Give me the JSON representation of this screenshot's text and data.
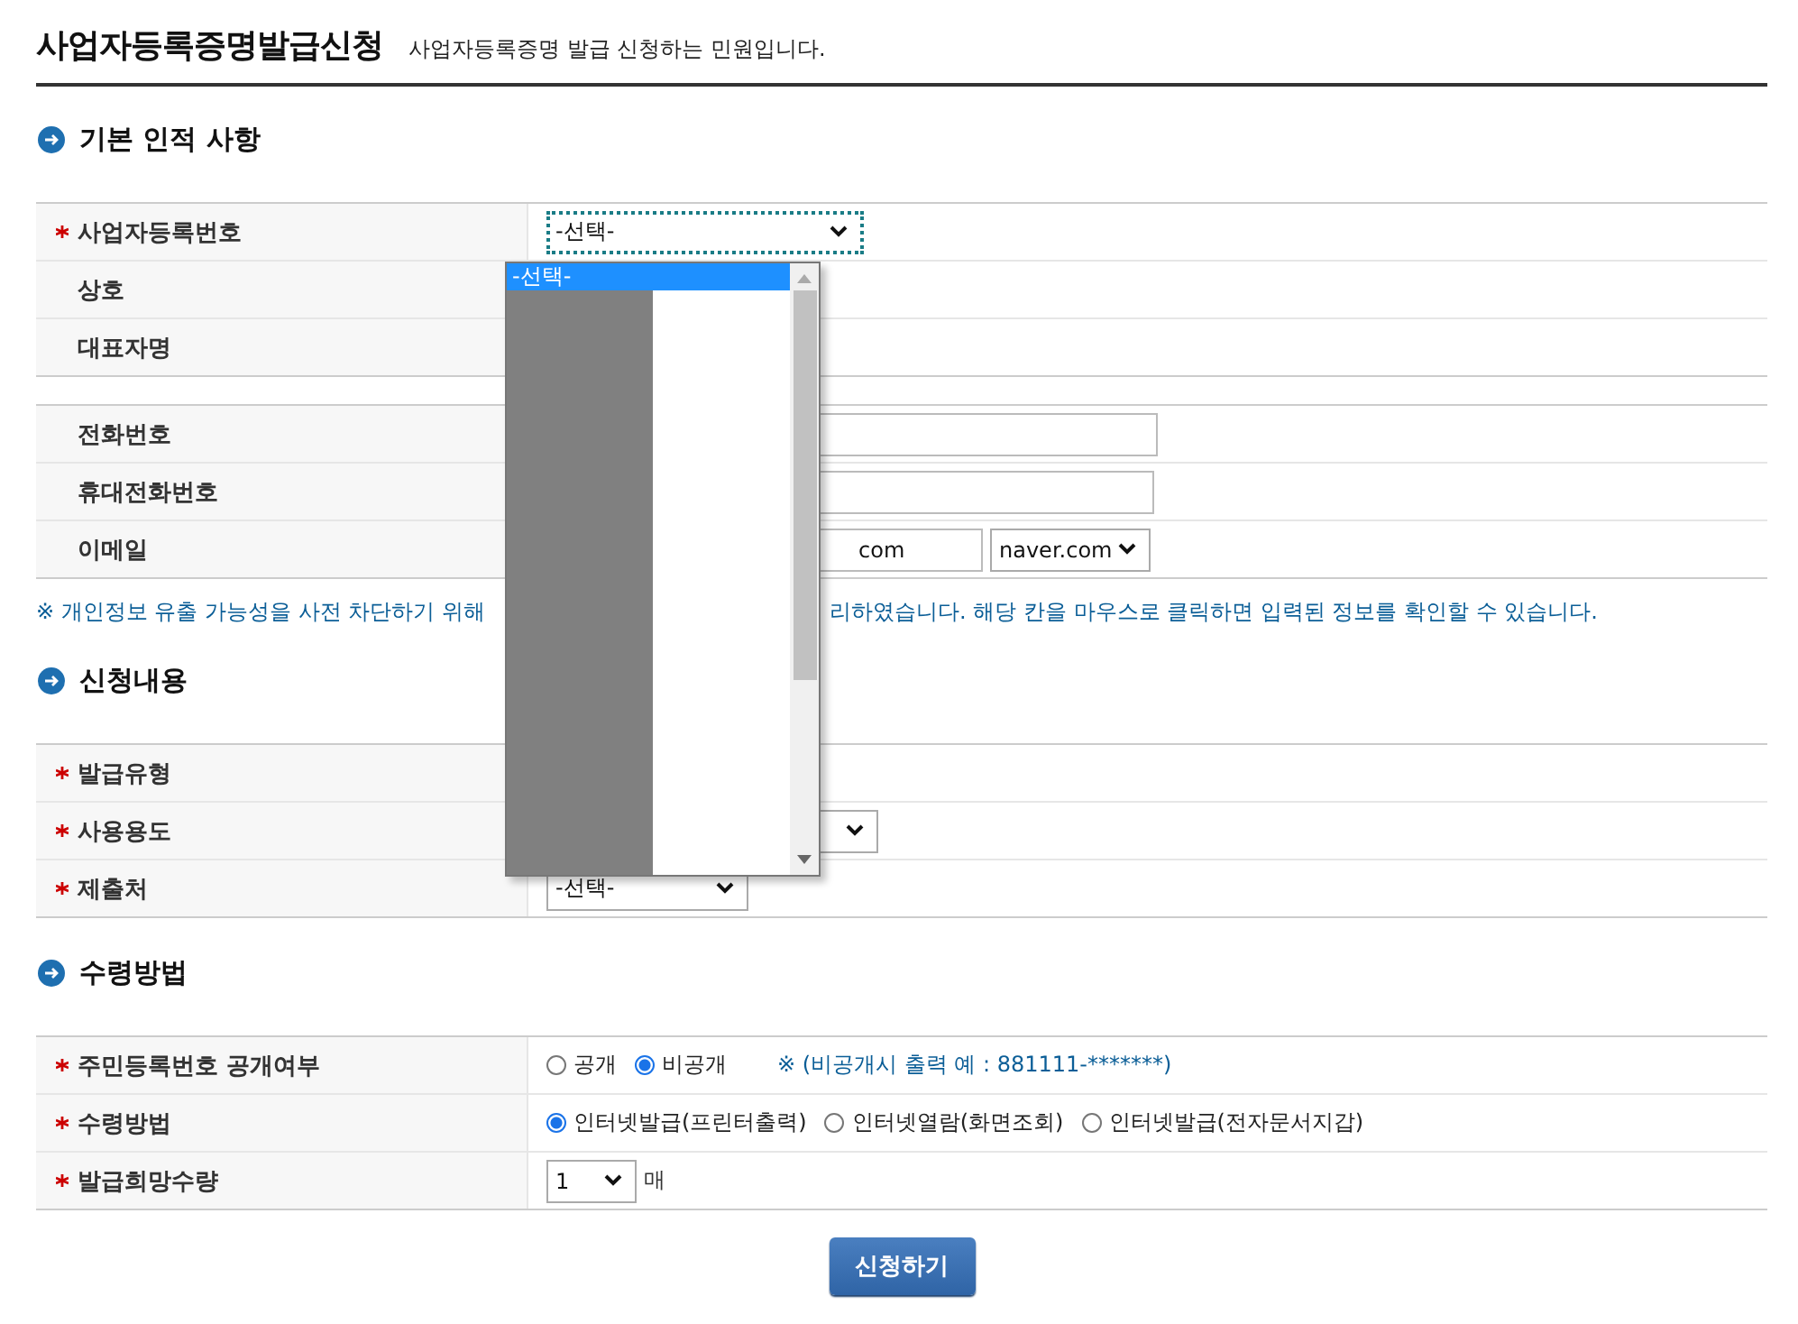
{
  "header": {
    "title": "사업자등록증명발급신청",
    "subtitle": "사업자등록증명 발급 신청하는 민원입니다."
  },
  "sections": [
    {
      "title": "기본 인적 사항",
      "groups": [
        [
          {
            "label": "사업자등록번호",
            "required": true,
            "kind": "select",
            "value": "-선택-",
            "focused": true
          },
          {
            "label": "상호",
            "required": false,
            "kind": "blank"
          },
          {
            "label": "대표자명",
            "required": false,
            "kind": "blank"
          }
        ],
        [
          {
            "label": "전화번호",
            "required": false,
            "kind": "text"
          },
          {
            "label": "휴대전화번호",
            "required": false,
            "kind": "text"
          },
          {
            "label": "이메일",
            "required": false,
            "kind": "email",
            "value": "com",
            "domain": "naver.com"
          }
        ]
      ],
      "notice": {
        "before": "※ 개인정보 유출 가능성을 사전 차단하기 위해",
        "after": "리하였습니다. 해당 칸을 마우스로 클릭하면 입력된 정보를 확인할 수 있습니다."
      }
    },
    {
      "title": "신청내용",
      "groups": [
        [
          {
            "label": "발급유형",
            "required": true,
            "kind": "blank"
          },
          {
            "label": "사용용도",
            "required": true,
            "kind": "select"
          },
          {
            "label": "제출처",
            "required": true,
            "kind": "select",
            "value": "-선택-"
          }
        ]
      ]
    },
    {
      "title": "수령방법",
      "groups": [
        [
          {
            "label": "주민등록번호 공개여부",
            "required": true,
            "kind": "radio",
            "options": [
              {
                "label": "공개",
                "selected": false
              },
              {
                "label": "비공개",
                "selected": true
              }
            ],
            "note": "※ (비공개시 출력 예 : 881111-*******)"
          },
          {
            "label": "수령방법",
            "required": true,
            "kind": "radio",
            "options": [
              {
                "label": "인터넷발급(프린터출력)",
                "selected": true
              },
              {
                "label": "인터넷열람(화면조회)",
                "selected": false
              },
              {
                "label": "인터넷발급(전자문서지갑)",
                "selected": false
              }
            ]
          },
          {
            "label": "발급희망수량",
            "required": true,
            "kind": "count",
            "value": "1",
            "unit": "매"
          }
        ]
      ]
    }
  ],
  "dropdown": {
    "options": [
      {
        "label": "-선택-",
        "selected": true
      }
    ]
  },
  "submit": "신청하기"
}
